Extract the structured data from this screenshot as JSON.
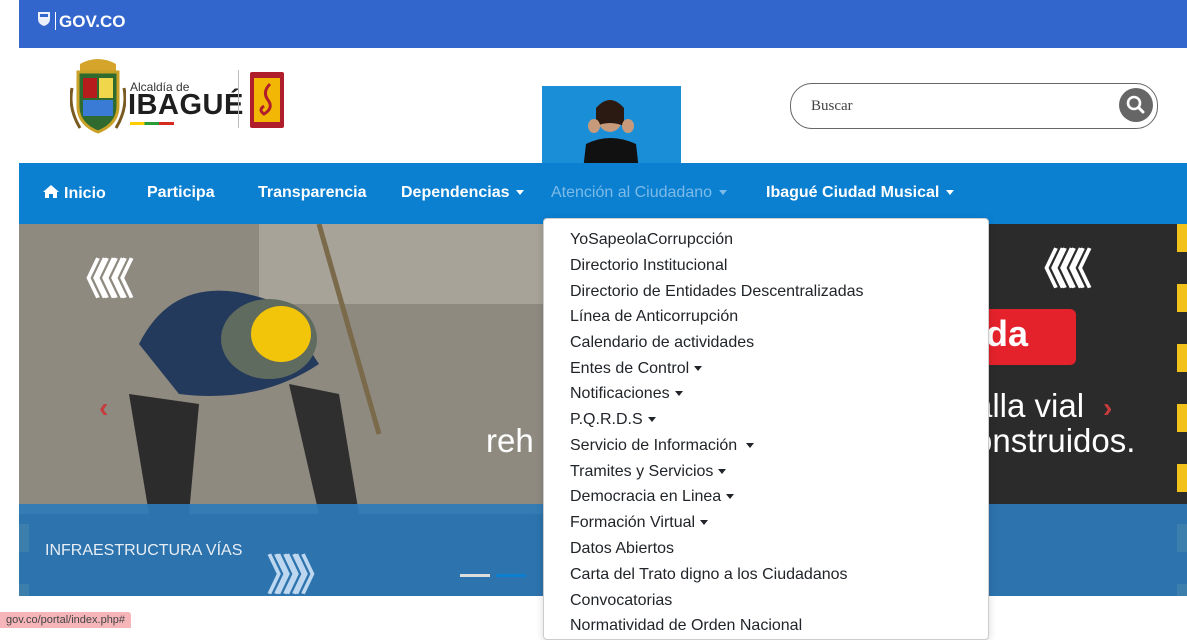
{
  "govbar": {
    "label": "GOV.CO",
    "icon": "colombia-shield-icon",
    "color": "#3366cc"
  },
  "header": {
    "logo_small": "Alcaldía de",
    "logo_big": "IBAGUÉ",
    "music_logo_icon": "treble-clef-icon",
    "sign_language_icon": "sign-language-interpreter-icon"
  },
  "search": {
    "placeholder": "Buscar",
    "icon": "search-icon"
  },
  "nav": {
    "color": "#0b7fd0",
    "items": [
      {
        "label": "Inicio",
        "icon": "home-icon"
      },
      {
        "label": "Participa"
      },
      {
        "label": "Transparencia"
      },
      {
        "label": "Dependencias"
      },
      {
        "label": "Atención al Ciudadano"
      },
      {
        "label": "Ibagué Ciudad Musical"
      }
    ]
  },
  "hero": {
    "badge": "da",
    "line1": "alla vial",
    "line2_left": "reh",
    "line2_right": "onstruidos.",
    "caption": "INFRAESTRUCTURA VÍAS",
    "left_chevrons": "《《《《",
    "right_chevrons": "《《《《",
    "bottom_chevrons": "》》》》"
  },
  "dropdown": {
    "items": [
      {
        "label": "YoSapeolaCorrupcción"
      },
      {
        "label": "Directorio Institucional"
      },
      {
        "label": "Directorio de Entidades Descentralizadas"
      },
      {
        "label": "Línea de Anticorrupción"
      },
      {
        "label": "Calendario de actividades"
      },
      {
        "label": "Entes de Control"
      },
      {
        "label": "Notificaciones"
      },
      {
        "label": "P.Q.R.D.S"
      },
      {
        "label": "Servicio de Información"
      },
      {
        "label": "Tramites y Servicios"
      },
      {
        "label": "Democracia en Linea"
      },
      {
        "label": "Formación Virtual"
      },
      {
        "label": "Datos Abiertos"
      },
      {
        "label": "Carta del Trato digno a los Ciudadanos"
      },
      {
        "label": "Convocatorias"
      },
      {
        "label": "Normatividad de Orden Nacional"
      }
    ]
  },
  "status": {
    "url": "gov.co/portal/index.php#"
  }
}
